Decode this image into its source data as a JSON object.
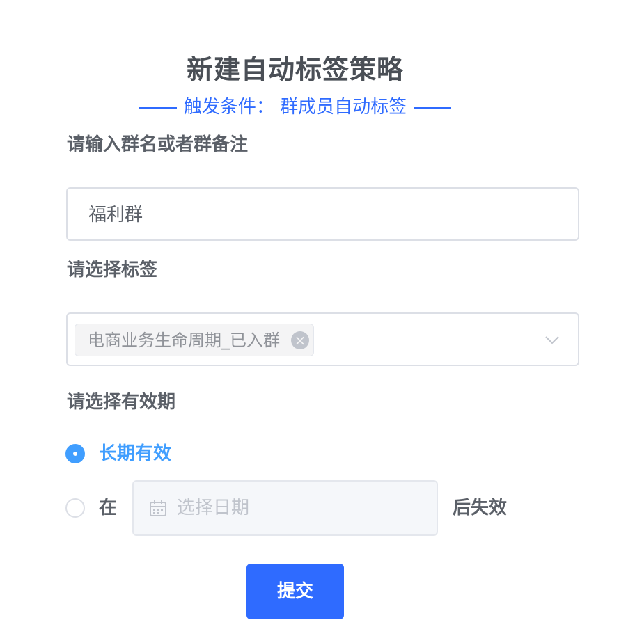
{
  "header": {
    "title": "新建自动标签策略",
    "subtitle_prefix": "触发条件：",
    "subtitle_value": "群成员自动标签"
  },
  "group_name": {
    "label": "请输入群名或者群备注",
    "value": "福利群"
  },
  "tag_select": {
    "label": "请选择标签",
    "selected_tags": [
      "电商业务生命周期_已入群"
    ],
    "dropdown_icon": "chevron-down-icon",
    "tag_close_icon": "close-circle-icon"
  },
  "validity": {
    "label": "请选择有效期",
    "options": [
      {
        "label": "长期有效",
        "checked": true
      },
      {
        "prefix": "在",
        "suffix": "后失效",
        "checked": false
      }
    ],
    "date_placeholder": "选择日期",
    "date_icon": "calendar-icon"
  },
  "actions": {
    "submit_label": "提交"
  },
  "colors": {
    "primary": "#2f6bff",
    "radio_active": "#409eff",
    "border": "#dcdfe6",
    "text": "#5b6068",
    "placeholder": "#c0c4cc"
  }
}
